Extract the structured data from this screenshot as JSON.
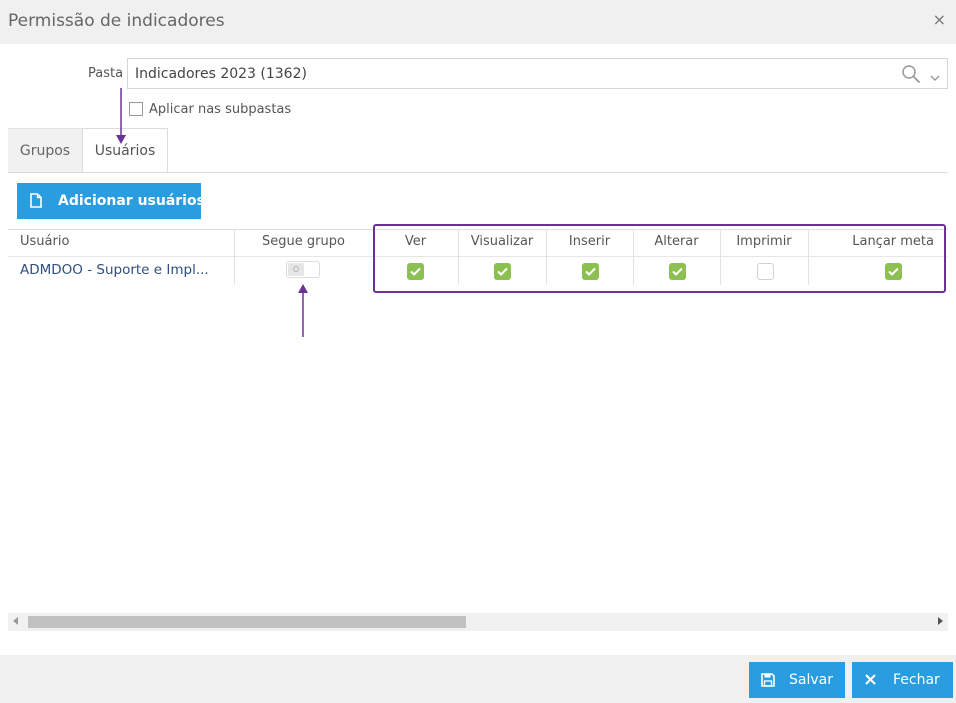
{
  "dialog": {
    "title": "Permissão de indicadores",
    "close_symbol": "×"
  },
  "form": {
    "pasta_label": "Pasta",
    "pasta_value": "Indicadores 2023 (1362)",
    "apply_subfolders_label": "Aplicar nas subpastas",
    "apply_subfolders_checked": false
  },
  "tabs": [
    {
      "label": "Grupos",
      "active": false
    },
    {
      "label": "Usuários",
      "active": true
    }
  ],
  "toolbar": {
    "add_users_label": "Adicionar usuários"
  },
  "grid": {
    "columns": [
      "Usuário",
      "Segue grupo",
      "Ver",
      "Visualizar",
      "Inserir",
      "Alterar",
      "Imprimir",
      "Lançar meta"
    ],
    "rows": [
      {
        "usuario": "ADMDOO - Suporte e Impl...",
        "segue_grupo": false,
        "toggle_text": "O",
        "permissions": {
          "ver": true,
          "visualizar": true,
          "inserir": true,
          "alterar": true,
          "imprimir": false,
          "lancar_meta": true
        }
      }
    ]
  },
  "footer": {
    "save_label": "Salvar",
    "close_label": "Fechar"
  },
  "icons": {
    "close": "close-icon",
    "search": "search-icon",
    "dropdown": "chevron-down-icon",
    "add": "document-icon",
    "save": "floppy-disk-icon",
    "fechar": "x-icon",
    "check": "check-icon"
  },
  "colors": {
    "primary": "#2a9de0",
    "check_on": "#8cc152",
    "annotation": "#6a3294",
    "header_bg": "#f0f0f0"
  }
}
